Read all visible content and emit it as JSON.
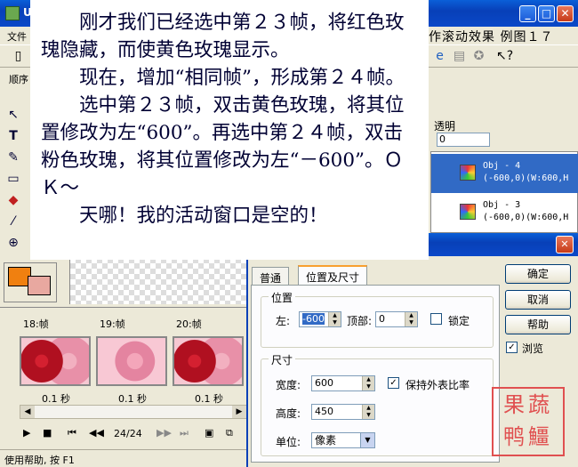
{
  "window": {
    "title_fragment": "U"
  },
  "menu": {
    "file": "文件",
    "right_text": "作滚动效果 例图１７"
  },
  "toolbar": {
    "sequence_label": "顺序"
  },
  "tools": [
    {
      "name": "arrow-tool-icon",
      "glyph": "↖"
    },
    {
      "name": "text-tool-icon",
      "glyph": "T"
    },
    {
      "name": "brush-tool-icon",
      "glyph": "✎"
    },
    {
      "name": "eraser-tool-icon",
      "glyph": "▭"
    },
    {
      "name": "fill-tool-icon",
      "glyph": "◆"
    },
    {
      "name": "picker-tool-icon",
      "glyph": "⁄"
    },
    {
      "name": "zoom-tool-icon",
      "glyph": "⊕"
    }
  ],
  "properties": {
    "transparency_label": "透明",
    "transparency_value": "0"
  },
  "objects": [
    {
      "name": "Obj - 4",
      "info": "(-600,0)(W:600,H"
    },
    {
      "name": "Obj - 3",
      "info": "(-600,0)(W:600,H"
    }
  ],
  "frames": [
    {
      "label": "18:帧",
      "delay": "0.1 秒"
    },
    {
      "label": "19:帧",
      "delay": "0.1 秒"
    },
    {
      "label": "20:帧",
      "delay": "0.1 秒"
    }
  ],
  "playback": {
    "counter": "24/24"
  },
  "status": {
    "text": "使用帮助, 按 F1"
  },
  "dialog": {
    "tabs": [
      "普通",
      "位置及尺寸"
    ],
    "position_group": "位置",
    "left_label": "左:",
    "left_value": "-600",
    "top_label": "顶部:",
    "top_value": "0",
    "lock_label": "锁定",
    "size_group": "尺寸",
    "width_label": "宽度:",
    "width_value": "600",
    "keep_ratio_label": "保持外表比率",
    "height_label": "高度:",
    "height_value": "450",
    "unit_label": "单位:",
    "unit_value": "像素",
    "ok_button": "确定",
    "cancel_button": "取消",
    "help_button": "帮助",
    "browse_label": "浏览"
  },
  "seal": {
    "text": "果蔬鸭䲔"
  },
  "overlay": {
    "paragraphs": [
      "刚才我们已经选中第２３帧，将红色玫瑰隐藏，而使黄色玫瑰显示。",
      "现在，增加“相同帧”，形成第２４帧。",
      "选中第２３帧，双击黄色玫瑰，将其位置修改为左“600”。再选中第２４帧，双击粉色玫瑰，将其位置修改为左“－600”。ＯＫ～",
      "天哪！我的活动窗口是空的！"
    ]
  }
}
